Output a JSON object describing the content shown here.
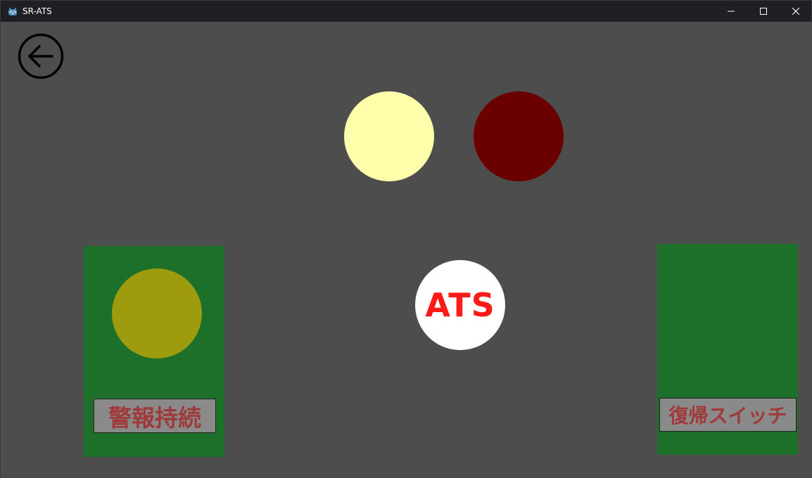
{
  "window": {
    "title": "SR-ATS",
    "app_icon": "godot-engine-icon",
    "controls": {
      "minimize_icon": "minimize-icon",
      "maximize_icon": "maximize-icon",
      "close_icon": "close-icon"
    }
  },
  "content": {
    "background_color": "#4d4d4d",
    "back_button": {
      "icon": "arrow-left-circle-icon"
    },
    "indicator_lamps": [
      {
        "name": "pale-yellow-lamp",
        "color": "#ffffab"
      },
      {
        "name": "dark-red-lamp",
        "color": "#6b0000"
      }
    ],
    "alarm_continue_panel": {
      "panel_color": "#1c7029",
      "lamp_color": "#9e9c0e",
      "label": "警報持続"
    },
    "reset_switch_panel": {
      "panel_color": "#1c7029",
      "label": "復帰スイッチ"
    },
    "ats_badge": {
      "label": "ATS",
      "text_color": "#ff1a1a",
      "background_color": "#ffffff"
    }
  }
}
